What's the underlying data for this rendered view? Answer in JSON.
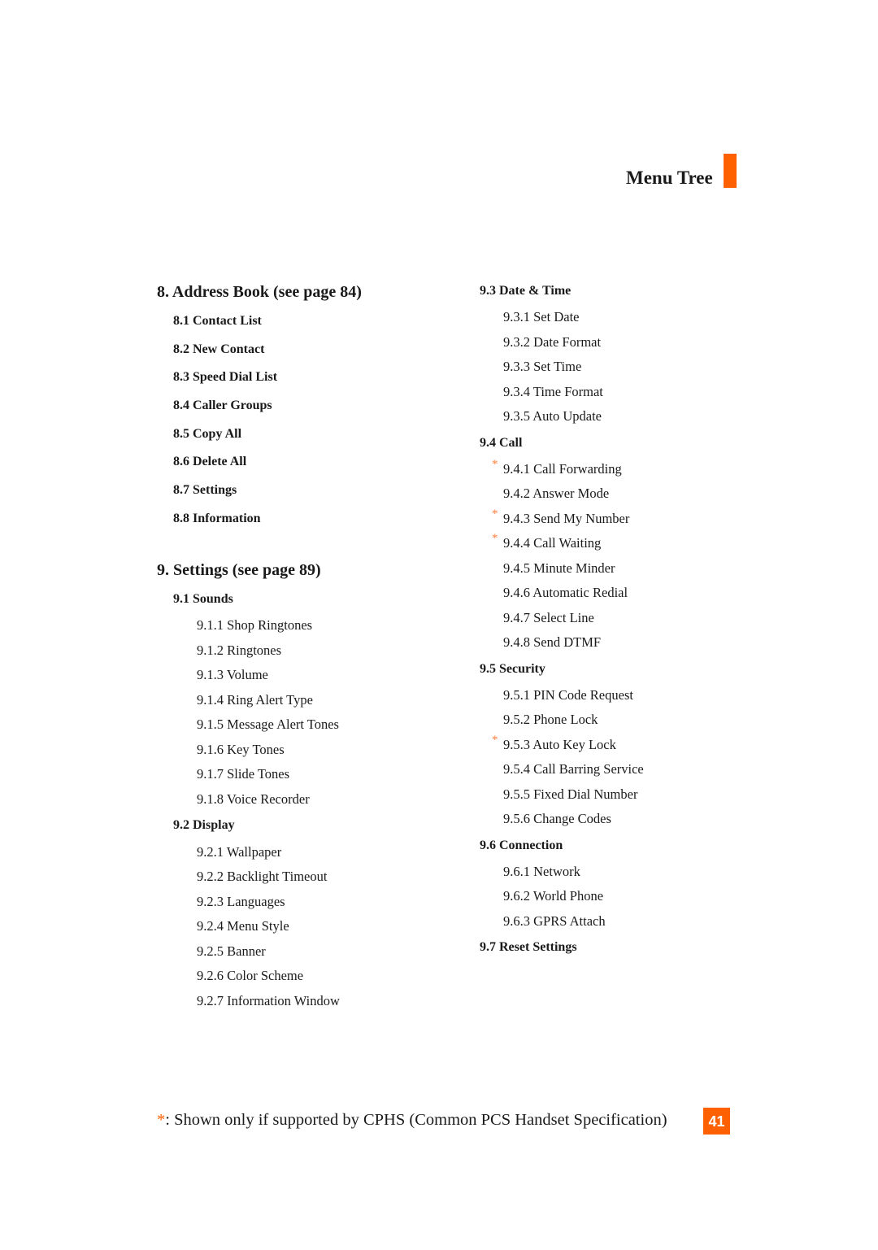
{
  "header": {
    "title": "Menu Tree",
    "accent_color": "#ff6000"
  },
  "left_column": [
    {
      "title": "8. Address Book (see page 84)",
      "subsections": [
        {
          "label": "8.1 Contact List",
          "items": []
        },
        {
          "label": "8.2 New Contact",
          "items": []
        },
        {
          "label": "8.3 Speed Dial List",
          "items": []
        },
        {
          "label": "8.4 Caller Groups",
          "items": []
        },
        {
          "label": "8.5 Copy All",
          "items": []
        },
        {
          "label": "8.6 Delete All",
          "items": []
        },
        {
          "label": "8.7 Settings",
          "items": []
        },
        {
          "label": "8.8 Information",
          "items": []
        }
      ]
    },
    {
      "title": "9. Settings (see page 89)",
      "subsections": [
        {
          "label": "9.1 Sounds",
          "items": [
            {
              "label": "9.1.1 Shop Ringtones",
              "cphs": false
            },
            {
              "label": "9.1.2 Ringtones",
              "cphs": false
            },
            {
              "label": "9.1.3 Volume",
              "cphs": false
            },
            {
              "label": "9.1.4 Ring Alert Type",
              "cphs": false
            },
            {
              "label": "9.1.5 Message Alert Tones",
              "cphs": false
            },
            {
              "label": "9.1.6 Key Tones",
              "cphs": false
            },
            {
              "label": "9.1.7 Slide Tones",
              "cphs": false
            },
            {
              "label": "9.1.8 Voice Recorder",
              "cphs": false
            }
          ]
        },
        {
          "label": "9.2 Display",
          "items": [
            {
              "label": "9.2.1 Wallpaper",
              "cphs": false
            },
            {
              "label": "9.2.2 Backlight Timeout",
              "cphs": false
            },
            {
              "label": "9.2.3 Languages",
              "cphs": false
            },
            {
              "label": "9.2.4 Menu Style",
              "cphs": false
            },
            {
              "label": "9.2.5 Banner",
              "cphs": false
            },
            {
              "label": "9.2.6 Color Scheme",
              "cphs": false
            },
            {
              "label": "9.2.7 Information Window",
              "cphs": false
            }
          ]
        }
      ]
    }
  ],
  "right_column": [
    {
      "label": "9.3 Date & Time",
      "items": [
        {
          "label": "9.3.1 Set Date",
          "cphs": false
        },
        {
          "label": "9.3.2 Date Format",
          "cphs": false
        },
        {
          "label": "9.3.3 Set Time",
          "cphs": false
        },
        {
          "label": "9.3.4 Time Format",
          "cphs": false
        },
        {
          "label": "9.3.5 Auto Update",
          "cphs": false
        }
      ]
    },
    {
      "label": "9.4 Call",
      "items": [
        {
          "label": "9.4.1 Call Forwarding",
          "cphs": true
        },
        {
          "label": "9.4.2 Answer Mode",
          "cphs": false
        },
        {
          "label": "9.4.3 Send My Number",
          "cphs": true
        },
        {
          "label": "9.4.4 Call Waiting",
          "cphs": true
        },
        {
          "label": "9.4.5 Minute Minder",
          "cphs": false
        },
        {
          "label": "9.4.6 Automatic Redial",
          "cphs": false
        },
        {
          "label": "9.4.7 Select Line",
          "cphs": false
        },
        {
          "label": "9.4.8 Send DTMF",
          "cphs": false
        }
      ]
    },
    {
      "label": "9.5 Security",
      "items": [
        {
          "label": "9.5.1 PIN Code Request",
          "cphs": false
        },
        {
          "label": "9.5.2 Phone Lock",
          "cphs": false
        },
        {
          "label": "9.5.3 Auto Key Lock",
          "cphs": true
        },
        {
          "label": "9.5.4 Call Barring Service",
          "cphs": false
        },
        {
          "label": "9.5.5 Fixed Dial Number",
          "cphs": false
        },
        {
          "label": "9.5.6 Change Codes",
          "cphs": false
        }
      ]
    },
    {
      "label": "9.6 Connection",
      "items": [
        {
          "label": "9.6.1 Network",
          "cphs": false
        },
        {
          "label": "9.6.2 World Phone",
          "cphs": false
        },
        {
          "label": "9.6.3 GPRS Attach",
          "cphs": false
        }
      ]
    },
    {
      "label": "9.7 Reset Settings",
      "items": []
    }
  ],
  "star_glyph": "*",
  "footnote": {
    "star": "*",
    "text": ": Shown only if supported by CPHS (Common PCS Handset Specification)"
  },
  "page_number": "41"
}
